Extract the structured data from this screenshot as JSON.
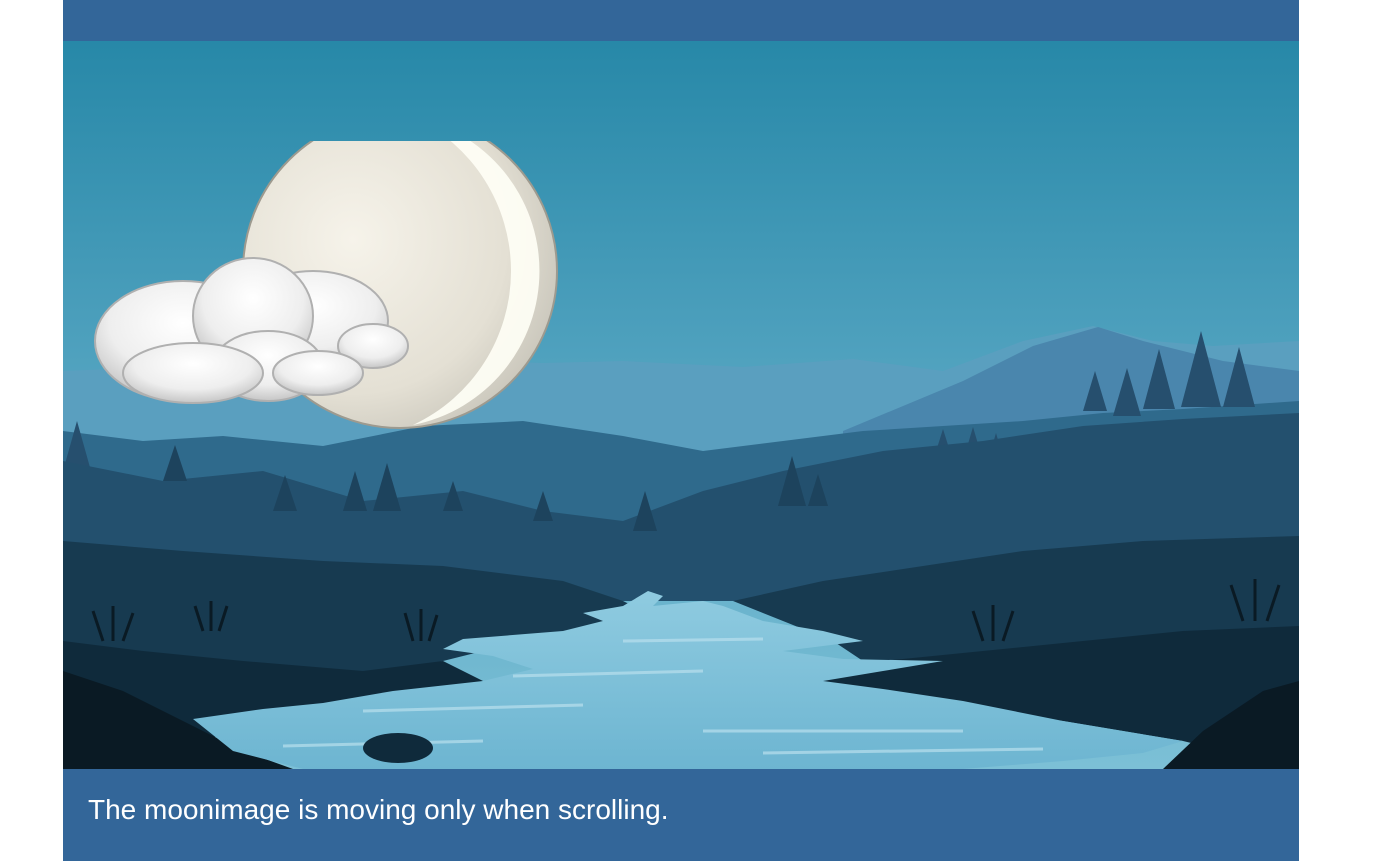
{
  "colors": {
    "page_bg": "#336699",
    "sky_top": "#2788a8",
    "sky_bottom": "#6fb3cc",
    "river": "#7cc0d9",
    "caption_text": "#ffffff"
  },
  "scene": {
    "illustration": "night-landscape-illustration",
    "moon_icon": "moon-icon",
    "cloud_icon": "cloud-icon"
  },
  "caption": {
    "text": "The moonimage is moving only when scrolling."
  }
}
